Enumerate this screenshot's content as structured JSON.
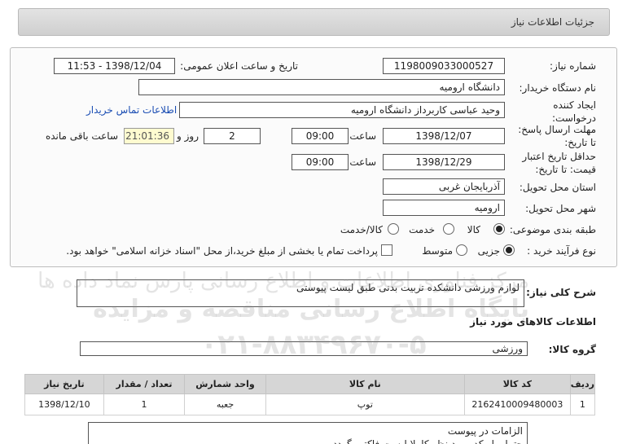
{
  "header": {
    "title": "جزئیات اطلاعات نیاز"
  },
  "form": {
    "need_number_label": "شماره نیاز:",
    "need_number": "1198009033000527",
    "announce_label": "تاریخ و ساعت اعلان عمومی:",
    "announce_value": "1398/12/04 - 11:53",
    "buyer_label": "نام دستگاه خریدار:",
    "buyer_value": "دانشگاه ارومیه",
    "creator_label_1": "ایجاد کننده",
    "creator_label_2": "درخواست:",
    "creator_value": "وحید عباسی کاربرداز دانشگاه ارومیه",
    "contact_link": "اطلاعات تماس خریدار",
    "deadline_label_1": "مهلت ارسال پاسخ:",
    "deadline_label_2": "تا تاریخ:",
    "deadline_date": "1398/12/07",
    "time_label": "ساعت",
    "deadline_time": "09:00",
    "days_value": "2",
    "days_label": "روز و",
    "remaining_time": "21:01:36",
    "remaining_label": "ساعت باقی مانده",
    "validity_label_1": "حداقل تاریخ اعتبار",
    "validity_label_2": "قیمت: تا تاریخ:",
    "validity_date": "1398/12/29",
    "validity_time": "09:00",
    "province_label": "استان محل تحویل:",
    "province_value": "آذربایجان غربی",
    "city_label": "شهر محل تحویل:",
    "city_value": "ارومیه",
    "category_label": "طبقه بندی موضوعی:",
    "category_options": [
      "کالا",
      "خدمت",
      "کالا/خدمت"
    ],
    "purchase_label": "نوع فرآیند خرید :",
    "purchase_options": [
      "جزیی",
      "متوسط"
    ],
    "payment_note": "پرداخت تمام یا بخشی از مبلغ خرید،از محل \"اسناد خزانه اسلامی\" خواهد بود."
  },
  "description": {
    "label": "شرح کلی نیاز:",
    "value": "لوازم ورزشی دانشکده تربیت بدنی طبق لیست پیوستی"
  },
  "goods_info_title": "اطلاعات کالاهای مورد نیاز",
  "goods_group": {
    "label": "گروه کالا:",
    "value": "ورزشی"
  },
  "table": {
    "headers": [
      "ردیف",
      "کد کالا",
      "نام کالا",
      "واحد شمارش",
      "تعداد / مقدار",
      "تاریخ نیاز"
    ],
    "rows": [
      [
        "1",
        "2162410009480003",
        "توپ",
        "جعبه",
        "1",
        "1398/12/10"
      ]
    ]
  },
  "requirements": {
    "line1": "الزامات در پیوست",
    "line2": "حتما و ایرکد مورد نظر کاملا لیست فاکتور گردد"
  },
  "watermark": {
    "line1": "مرکز فناوری اطلاعات و اطلاع رسانی پارس نماد داده ها",
    "line2": "پایگاه اطلاع رسانی مناقصه و مزایده",
    "line3": "۰۲۱-۸۸۳۴۹۶۷۰-۵"
  }
}
